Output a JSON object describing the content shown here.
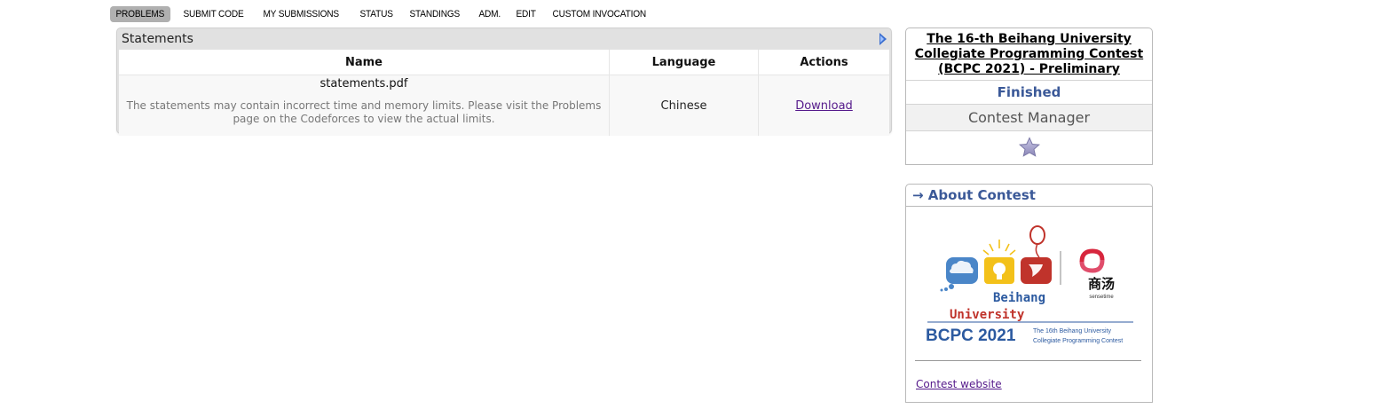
{
  "nav": {
    "items": [
      "PROBLEMS",
      "SUBMIT CODE",
      "MY SUBMISSIONS",
      "STATUS",
      "STANDINGS",
      "ADM.",
      "EDIT",
      "CUSTOM INVOCATION"
    ],
    "active": "PROBLEMS"
  },
  "statements": {
    "caption": "Statements",
    "headers": {
      "name": "Name",
      "language": "Language",
      "actions": "Actions"
    },
    "row": {
      "file": "statements.pdf",
      "note": "The statements may contain incorrect time and memory limits. Please visit the Problems page on the Codeforces to view the actual limits.",
      "language": "Chinese",
      "action": "Download"
    }
  },
  "contest": {
    "title": "The 16-th Beihang University Collegiate Programming Contest (BCPC 2021) - Preliminary",
    "status": "Finished",
    "manager_label": "Contest Manager",
    "star_icon": "star-icon"
  },
  "about": {
    "caption": "→ About Contest",
    "logo": {
      "university_line1": "Beihang",
      "university_line2": "University",
      "sponsor_cn": "商汤",
      "sponsor_en": "sensetime",
      "bcpc": "BCPC 2021",
      "contest_line1": "The 16th Beihang University",
      "contest_line2": "Collegiate Programming Contest"
    },
    "website_link": "Contest website"
  },
  "colors": {
    "link_visited": "#551a8b",
    "accent_blue": "#3b5998",
    "nav_active_bg": "#b0b0b0"
  }
}
